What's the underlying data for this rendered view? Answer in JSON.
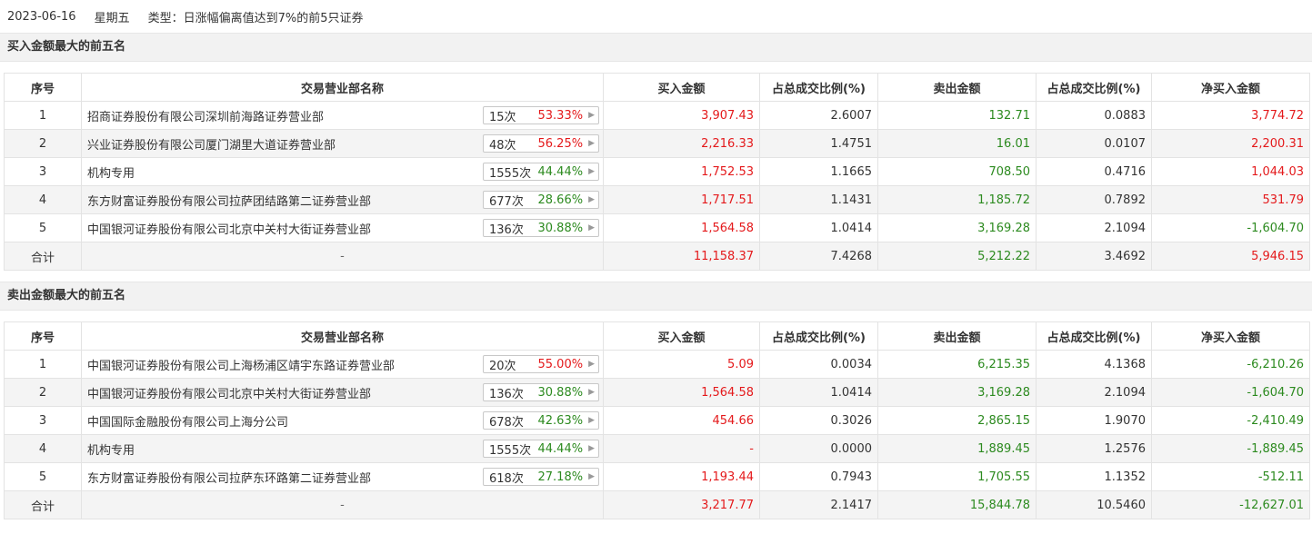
{
  "header": {
    "date": "2023-06-16",
    "weekday": "星期五",
    "type_label": "类型：",
    "type_value": "日涨幅偏离值达到7%的前5只证券"
  },
  "columns": [
    "序号",
    "交易营业部名称",
    "买入金额",
    "占总成交比例(%)",
    "卖出金额",
    "占总成交比例(%)",
    "净买入金额"
  ],
  "buy_section": {
    "title": "买入金额最大的前五名",
    "rows": [
      {
        "idx": "1",
        "name": "招商证券股份有限公司深圳前海路证券营业部",
        "count": "15次",
        "pct": "53.33%",
        "pct_color": "red",
        "buy": "3,907.43",
        "buy_ratio": "2.6007",
        "sell": "132.71",
        "sell_ratio": "0.0883",
        "net": "3,774.72",
        "net_color": "red"
      },
      {
        "idx": "2",
        "name": "兴业证券股份有限公司厦门湖里大道证券营业部",
        "count": "48次",
        "pct": "56.25%",
        "pct_color": "red",
        "buy": "2,216.33",
        "buy_ratio": "1.4751",
        "sell": "16.01",
        "sell_ratio": "0.0107",
        "net": "2,200.31",
        "net_color": "red"
      },
      {
        "idx": "3",
        "name": "机构专用",
        "count": "1555次",
        "pct": "44.44%",
        "pct_color": "green",
        "buy": "1,752.53",
        "buy_ratio": "1.1665",
        "sell": "708.50",
        "sell_ratio": "0.4716",
        "net": "1,044.03",
        "net_color": "red"
      },
      {
        "idx": "4",
        "name": "东方财富证券股份有限公司拉萨团结路第二证券营业部",
        "count": "677次",
        "pct": "28.66%",
        "pct_color": "green",
        "buy": "1,717.51",
        "buy_ratio": "1.1431",
        "sell": "1,185.72",
        "sell_ratio": "0.7892",
        "net": "531.79",
        "net_color": "red"
      },
      {
        "idx": "5",
        "name": "中国银河证券股份有限公司北京中关村大街证券营业部",
        "count": "136次",
        "pct": "30.88%",
        "pct_color": "green",
        "buy": "1,564.58",
        "buy_ratio": "1.0414",
        "sell": "3,169.28",
        "sell_ratio": "2.1094",
        "net": "-1,604.70",
        "net_color": "green"
      }
    ],
    "total": {
      "label": "合计",
      "name": "-",
      "buy": "11,158.37",
      "buy_ratio": "7.4268",
      "sell": "5,212.22",
      "sell_ratio": "3.4692",
      "net": "5,946.15",
      "net_color": "red"
    }
  },
  "sell_section": {
    "title": "卖出金额最大的前五名",
    "rows": [
      {
        "idx": "1",
        "name": "中国银河证券股份有限公司上海杨浦区靖宇东路证券营业部",
        "count": "20次",
        "pct": "55.00%",
        "pct_color": "red",
        "buy": "5.09",
        "buy_ratio": "0.0034",
        "sell": "6,215.35",
        "sell_ratio": "4.1368",
        "net": "-6,210.26",
        "net_color": "green"
      },
      {
        "idx": "2",
        "name": "中国银河证券股份有限公司北京中关村大街证券营业部",
        "count": "136次",
        "pct": "30.88%",
        "pct_color": "green",
        "buy": "1,564.58",
        "buy_ratio": "1.0414",
        "sell": "3,169.28",
        "sell_ratio": "2.1094",
        "net": "-1,604.70",
        "net_color": "green"
      },
      {
        "idx": "3",
        "name": "中国国际金融股份有限公司上海分公司",
        "count": "678次",
        "pct": "42.63%",
        "pct_color": "green",
        "buy": "454.66",
        "buy_ratio": "0.3026",
        "sell": "2,865.15",
        "sell_ratio": "1.9070",
        "net": "-2,410.49",
        "net_color": "green"
      },
      {
        "idx": "4",
        "name": "机构专用",
        "count": "1555次",
        "pct": "44.44%",
        "pct_color": "green",
        "buy": "-",
        "buy_ratio": "0.0000",
        "sell": "1,889.45",
        "sell_ratio": "1.2576",
        "net": "-1,889.45",
        "net_color": "green"
      },
      {
        "idx": "5",
        "name": "东方财富证券股份有限公司拉萨东环路第二证券营业部",
        "count": "618次",
        "pct": "27.18%",
        "pct_color": "green",
        "buy": "1,193.44",
        "buy_ratio": "0.7943",
        "sell": "1,705.55",
        "sell_ratio": "1.1352",
        "net": "-512.11",
        "net_color": "green"
      }
    ],
    "total": {
      "label": "合计",
      "name": "-",
      "buy": "3,217.77",
      "buy_ratio": "2.1417",
      "sell": "15,844.78",
      "sell_ratio": "10.5460",
      "net": "-12,627.01",
      "net_color": "green"
    }
  },
  "colors": {
    "red": "#e4191b",
    "green": "#2c8a1f"
  }
}
